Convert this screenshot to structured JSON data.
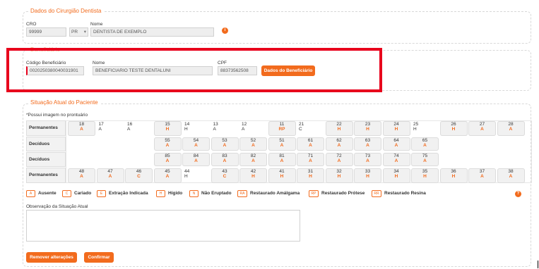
{
  "dentista": {
    "legend": "Dados do Cirurgião Dentista",
    "cro_label": "CRO",
    "cro_value": "99999",
    "uf_value": "PR",
    "uf_arrow": "▾",
    "nome_label": "Nome",
    "nome_value": "DENTISTA DE EXEMPLO",
    "info_glyph": "i"
  },
  "beneficiario": {
    "legend": "Beneficiário",
    "codigo_label": "Código Beneficiário",
    "codigo_value": "0020250380040031901",
    "nome_label": "Nome",
    "nome_value": "BENEFICIARIO TESTE DENTALUNI",
    "cpf_label": "CPF",
    "cpf_value": "88373562508",
    "button_label": "Dados do Beneficiário"
  },
  "situacao": {
    "legend": "Situação Atual do Paciente",
    "imagem_note": "*Possui imagem no prontuário",
    "row_labels": [
      "Permanentes",
      "Decíduos",
      "Decíduos",
      "Permanentes"
    ],
    "rows": [
      [
        {
          "n": "18",
          "s": "A",
          "m": true
        },
        {
          "n": "17",
          "s": "A",
          "m": false
        },
        {
          "n": "16",
          "s": "A",
          "m": false
        },
        {
          "n": "15",
          "s": "H",
          "m": true
        },
        {
          "n": "14",
          "s": "H",
          "m": false
        },
        {
          "n": "13",
          "s": "A",
          "m": false
        },
        {
          "n": "12",
          "s": "A",
          "m": false
        },
        {
          "n": "11",
          "s": "RP",
          "m": true
        },
        {
          "n": "21",
          "s": "C",
          "m": false
        },
        {
          "n": "22",
          "s": "H",
          "m": true
        },
        {
          "n": "23",
          "s": "H",
          "m": true
        },
        {
          "n": "24",
          "s": "H",
          "m": true
        },
        {
          "n": "25",
          "s": "H",
          "m": false
        },
        {
          "n": "26",
          "s": "H",
          "m": true
        },
        {
          "n": "27",
          "s": "A",
          "m": true
        },
        {
          "n": "28",
          "s": "A",
          "m": true
        }
      ],
      [
        {
          "n": "55",
          "s": "A",
          "m": true
        },
        {
          "n": "54",
          "s": "A",
          "m": true
        },
        {
          "n": "53",
          "s": "A",
          "m": true
        },
        {
          "n": "52",
          "s": "A",
          "m": true
        },
        {
          "n": "51",
          "s": "A",
          "m": true
        },
        {
          "n": "61",
          "s": "A",
          "m": true
        },
        {
          "n": "62",
          "s": "A",
          "m": true
        },
        {
          "n": "63",
          "s": "A",
          "m": true
        },
        {
          "n": "64",
          "s": "A",
          "m": true
        },
        {
          "n": "65",
          "s": "A",
          "m": true
        }
      ],
      [
        {
          "n": "85",
          "s": "A",
          "m": true
        },
        {
          "n": "84",
          "s": "A",
          "m": true
        },
        {
          "n": "83",
          "s": "A",
          "m": true
        },
        {
          "n": "82",
          "s": "A",
          "m": true
        },
        {
          "n": "81",
          "s": "A",
          "m": true
        },
        {
          "n": "71",
          "s": "A",
          "m": true
        },
        {
          "n": "72",
          "s": "A",
          "m": true
        },
        {
          "n": "73",
          "s": "A",
          "m": true
        },
        {
          "n": "74",
          "s": "A",
          "m": true
        },
        {
          "n": "75",
          "s": "A",
          "m": true
        }
      ],
      [
        {
          "n": "48",
          "s": "A",
          "m": true
        },
        {
          "n": "47",
          "s": "A",
          "m": true
        },
        {
          "n": "46",
          "s": "C",
          "m": true
        },
        {
          "n": "45",
          "s": "A",
          "m": true
        },
        {
          "n": "44",
          "s": "H",
          "m": false
        },
        {
          "n": "43",
          "s": "C",
          "m": true
        },
        {
          "n": "42",
          "s": "H",
          "m": true
        },
        {
          "n": "41",
          "s": "H",
          "m": true
        },
        {
          "n": "31",
          "s": "H",
          "m": true
        },
        {
          "n": "32",
          "s": "H",
          "m": true
        },
        {
          "n": "33",
          "s": "H",
          "m": true
        },
        {
          "n": "34",
          "s": "H",
          "m": true
        },
        {
          "n": "35",
          "s": "H",
          "m": true
        },
        {
          "n": "36",
          "s": "H",
          "m": true
        },
        {
          "n": "37",
          "s": "A",
          "m": true
        },
        {
          "n": "38",
          "s": "A",
          "m": true
        }
      ]
    ],
    "legend_items": [
      {
        "code": "A",
        "label": "Ausente"
      },
      {
        "code": "C",
        "label": "Cariado"
      },
      {
        "code": "E",
        "label": "Extração Indicada"
      },
      {
        "code": "H",
        "label": "Hígido"
      },
      {
        "code": "N",
        "label": "Não Eruptado"
      },
      {
        "code": "RA",
        "label": "Restaurado Amálgama"
      },
      {
        "code": "RP",
        "label": "Restaurado Prótese"
      },
      {
        "code": "RR",
        "label": "Restaurado Resina"
      }
    ],
    "help_glyph": "?",
    "observacao_label": "Observação da Situação Atual",
    "observacao_value": "",
    "remover_label": "Remover alterações",
    "confirmar_label": "Confirmar"
  },
  "colors": {
    "accent": "#f26b1d",
    "highlight": "#e8001c"
  }
}
